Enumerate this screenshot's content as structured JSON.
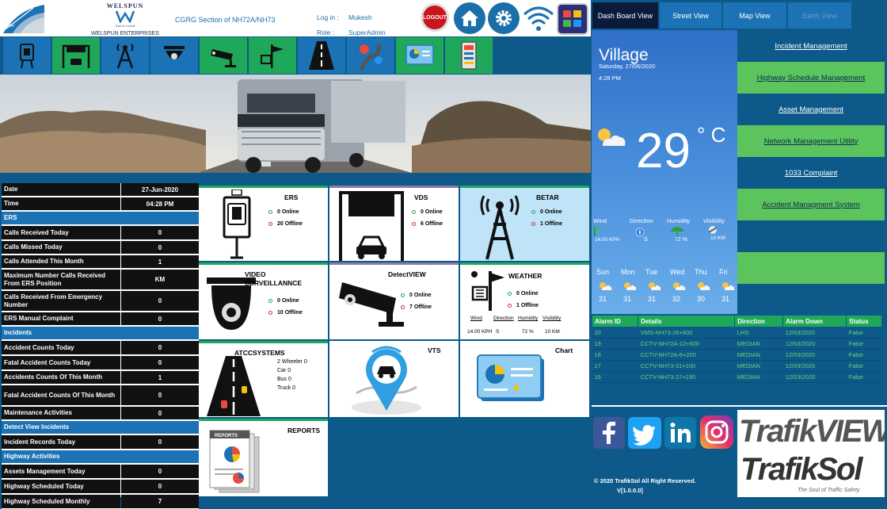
{
  "header": {
    "brand": "WELSPUN",
    "tagline": "Dare to Commit",
    "enterprise": "WELSPUN ENTERPRISES LTD",
    "section": "CGRG Section of NH72A/NH73",
    "login_label": "Log in :",
    "login_value": "Mukesh",
    "role_label": "Role :",
    "role_value": "SuperAdmin",
    "logout_label": "LOGOUT"
  },
  "modules": [
    "phone-booth-icon",
    "vehicle-detection-icon",
    "tower-icon",
    "camera-dome-icon",
    "cctv-icon",
    "weather-station-icon",
    "road-icon",
    "map-pin-icon",
    "chart-icon",
    "device-icon"
  ],
  "tabs": [
    "Dash Board View",
    "Street View",
    "Map View",
    "Earth View"
  ],
  "weather": {
    "location": "Village",
    "date": "Saturday, 27/06/2020",
    "time": "4:28 PM",
    "temp": "29",
    "unit": "° C",
    "labels": [
      "Wind",
      "Direction",
      "Humidity",
      "Visibility"
    ],
    "values": [
      "14.00 KPH",
      "S",
      "72 %",
      "10 KM"
    ],
    "days": [
      "Sun",
      "Mon",
      "Tue",
      "Wed",
      "Thu",
      "Fri"
    ],
    "temps": [
      "31",
      "31",
      "31",
      "32",
      "30",
      "31"
    ]
  },
  "nav": [
    "Incident Management",
    "Highway Schedule Management",
    "Asset Management",
    "Network Management Utility",
    "1033 Complaint",
    "Accident Managment System",
    "",
    ""
  ],
  "table": [
    {
      "l": "Date",
      "v": "27-Jun-2020",
      "h": 17
    },
    {
      "l": "Time",
      "v": "04:28 PM",
      "h": 17
    },
    {
      "l": "ERS",
      "sec": true,
      "h": 17
    },
    {
      "l": "Calls Received Today",
      "v": "0",
      "h": 18
    },
    {
      "l": "Calls Missed Today",
      "v": "0",
      "h": 17
    },
    {
      "l": "Calls Attended This Month",
      "v": "1",
      "h": 17
    },
    {
      "l": "Maximum Number Calls Received From ERS Position",
      "v": "KM",
      "h": 26
    },
    {
      "l": "Calls Received From Emergency Number",
      "v": "0",
      "h": 26
    },
    {
      "l": "ERS Manual Complaint",
      "v": "0",
      "h": 17
    },
    {
      "l": "Incidents",
      "sec": true,
      "h": 17
    },
    {
      "l": "Accident Counts Today",
      "v": "0",
      "h": 18
    },
    {
      "l": "Fatal Accident Counts Today",
      "v": "0",
      "h": 18
    },
    {
      "l": "Accidents Counts Of This Month",
      "v": "1",
      "h": 17
    },
    {
      "l": "Fatal Accident Counts Of This Month",
      "v": "0",
      "h": 26
    },
    {
      "l": "Maintenance Activities",
      "v": "0",
      "h": 17
    },
    {
      "l": "Detect View Incidents",
      "sec": true,
      "h": 17
    },
    {
      "l": "Incident Records Today",
      "v": "0",
      "h": 18
    },
    {
      "l": "Highway Activities",
      "sec": true,
      "h": 17
    },
    {
      "l": "Assets Management Today",
      "v": "0",
      "h": 18
    },
    {
      "l": "Highway Scheduled Today",
      "v": "0",
      "h": 18
    },
    {
      "l": "Highway Scheduled Monthly",
      "v": "7",
      "h": 18
    }
  ],
  "tiles": {
    "ers": {
      "title": "ERS",
      "online": "0 Online",
      "offline": "20 Offline"
    },
    "vds": {
      "title": "VDS",
      "online": "0 Online",
      "offline": "6 Offline"
    },
    "betar": {
      "title": "BETAR",
      "online": "0 Online",
      "offline": "1 Offline"
    },
    "video": {
      "title1": "VIDEO",
      "title2": "SURVEILLANNCE",
      "online": "0 Online",
      "offline": "10 Offline"
    },
    "detect": {
      "title": "DetectVIEW",
      "online": "0 Online",
      "offline": "7 Offline"
    },
    "weather": {
      "title": "WEATHER",
      "online": "0 Online",
      "offline": "1 Offline",
      "labels": [
        "Wind",
        "Direction",
        "Humidity",
        "Visibility"
      ],
      "values": [
        "14.00 KPH",
        "S",
        "72 %",
        "10 KM"
      ]
    },
    "atcc": {
      "title": "ATCCSYSTEMS",
      "items": [
        "2 Wheeler 0",
        "Car 0",
        "Bus 0",
        "Truck 0"
      ]
    },
    "vts": {
      "title": "VTS"
    },
    "chart": {
      "title": "Chart"
    },
    "reports": {
      "title": "REPORTS",
      "doc": "REPORTS"
    }
  },
  "alarm": {
    "headers": [
      "Alarm ID",
      "Details",
      "Direction",
      "Alarm Down",
      "Status"
    ],
    "rows": [
      [
        "20",
        "VMS-NH73-26+600",
        "LHS",
        "12/03/2020",
        "False"
      ],
      [
        "19",
        "CCTV-NH72A-12+600",
        "MEDIAN",
        "12/03/2020",
        "False"
      ],
      [
        "18",
        "CCTV-NH72A-6+200",
        "MEDIAN",
        "12/03/2020",
        "False"
      ],
      [
        "17",
        "CCTV-NH73-31+100",
        "MEDIAN",
        "12/03/2020",
        "False"
      ],
      [
        "16",
        "CCTV-NH73-27+190",
        "MEDIAN",
        "12/03/2020",
        "False"
      ]
    ]
  },
  "footer": {
    "copyright": "© 2020 TrafikSol All Right Reserved.",
    "version": "V[1.0.0.0]",
    "trafikview": "TrafikVIEW",
    "trafiksol": "TrafikSol",
    "slogan": "The Soul of Traffic Safety"
  },
  "colors": {
    "accent": "#0d5a8a",
    "green": "#1fa85a",
    "blue": "#1b72b4"
  }
}
